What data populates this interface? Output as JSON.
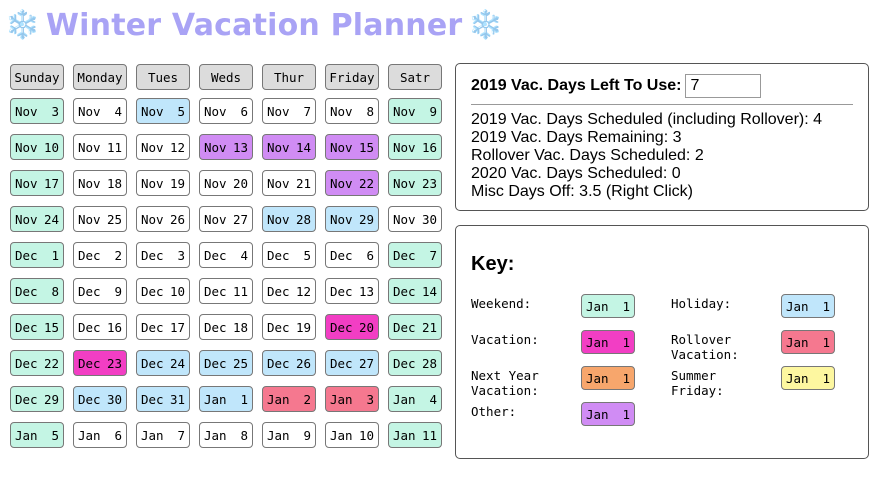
{
  "header": {
    "title": "Winter Vacation Planner",
    "icon_left": "❄️",
    "icon_right": "❄️"
  },
  "colors": {
    "weekend": "#c4f5e4",
    "holiday": "#c0e6fb",
    "vacation": "#f23ec4",
    "rollover": "#f5788f",
    "next_year": "#f7a66c",
    "summer_friday": "#fdf7a0",
    "other": "#d08cf4",
    "none": "#ffffff"
  },
  "calendar": {
    "headers": [
      "Sunday",
      "Monday",
      "Tues",
      "Weds",
      "Thur",
      "Friday",
      "Satr"
    ],
    "weeks": [
      [
        {
          "m": "Nov",
          "d": "3",
          "t": "weekend"
        },
        {
          "m": "Nov",
          "d": "4",
          "t": "none"
        },
        {
          "m": "Nov",
          "d": "5",
          "t": "holiday"
        },
        {
          "m": "Nov",
          "d": "6",
          "t": "none"
        },
        {
          "m": "Nov",
          "d": "7",
          "t": "none"
        },
        {
          "m": "Nov",
          "d": "8",
          "t": "none"
        },
        {
          "m": "Nov",
          "d": "9",
          "t": "weekend"
        }
      ],
      [
        {
          "m": "Nov",
          "d": "10",
          "t": "weekend"
        },
        {
          "m": "Nov",
          "d": "11",
          "t": "none"
        },
        {
          "m": "Nov",
          "d": "12",
          "t": "none"
        },
        {
          "m": "Nov",
          "d": "13",
          "t": "other"
        },
        {
          "m": "Nov",
          "d": "14",
          "t": "other"
        },
        {
          "m": "Nov",
          "d": "15",
          "t": "other"
        },
        {
          "m": "Nov",
          "d": "16",
          "t": "weekend"
        }
      ],
      [
        {
          "m": "Nov",
          "d": "17",
          "t": "weekend"
        },
        {
          "m": "Nov",
          "d": "18",
          "t": "none"
        },
        {
          "m": "Nov",
          "d": "19",
          "t": "none"
        },
        {
          "m": "Nov",
          "d": "20",
          "t": "none"
        },
        {
          "m": "Nov",
          "d": "21",
          "t": "none"
        },
        {
          "m": "Nov",
          "d": "22",
          "t": "other"
        },
        {
          "m": "Nov",
          "d": "23",
          "t": "weekend"
        }
      ],
      [
        {
          "m": "Nov",
          "d": "24",
          "t": "weekend"
        },
        {
          "m": "Nov",
          "d": "25",
          "t": "none"
        },
        {
          "m": "Nov",
          "d": "26",
          "t": "none"
        },
        {
          "m": "Nov",
          "d": "27",
          "t": "none"
        },
        {
          "m": "Nov",
          "d": "28",
          "t": "holiday"
        },
        {
          "m": "Nov",
          "d": "29",
          "t": "holiday"
        },
        {
          "m": "Nov",
          "d": "30",
          "t": "none"
        }
      ],
      [
        {
          "m": "Dec",
          "d": "1",
          "t": "weekend"
        },
        {
          "m": "Dec",
          "d": "2",
          "t": "none"
        },
        {
          "m": "Dec",
          "d": "3",
          "t": "none"
        },
        {
          "m": "Dec",
          "d": "4",
          "t": "none"
        },
        {
          "m": "Dec",
          "d": "5",
          "t": "none"
        },
        {
          "m": "Dec",
          "d": "6",
          "t": "none"
        },
        {
          "m": "Dec",
          "d": "7",
          "t": "weekend"
        }
      ],
      [
        {
          "m": "Dec",
          "d": "8",
          "t": "weekend"
        },
        {
          "m": "Dec",
          "d": "9",
          "t": "none"
        },
        {
          "m": "Dec",
          "d": "10",
          "t": "none"
        },
        {
          "m": "Dec",
          "d": "11",
          "t": "none"
        },
        {
          "m": "Dec",
          "d": "12",
          "t": "none"
        },
        {
          "m": "Dec",
          "d": "13",
          "t": "none"
        },
        {
          "m": "Dec",
          "d": "14",
          "t": "weekend"
        }
      ],
      [
        {
          "m": "Dec",
          "d": "15",
          "t": "weekend"
        },
        {
          "m": "Dec",
          "d": "16",
          "t": "none"
        },
        {
          "m": "Dec",
          "d": "17",
          "t": "none"
        },
        {
          "m": "Dec",
          "d": "18",
          "t": "none"
        },
        {
          "m": "Dec",
          "d": "19",
          "t": "none"
        },
        {
          "m": "Dec",
          "d": "20",
          "t": "vacation"
        },
        {
          "m": "Dec",
          "d": "21",
          "t": "weekend"
        }
      ],
      [
        {
          "m": "Dec",
          "d": "22",
          "t": "weekend"
        },
        {
          "m": "Dec",
          "d": "23",
          "t": "vacation"
        },
        {
          "m": "Dec",
          "d": "24",
          "t": "holiday"
        },
        {
          "m": "Dec",
          "d": "25",
          "t": "holiday"
        },
        {
          "m": "Dec",
          "d": "26",
          "t": "holiday"
        },
        {
          "m": "Dec",
          "d": "27",
          "t": "holiday"
        },
        {
          "m": "Dec",
          "d": "28",
          "t": "weekend"
        }
      ],
      [
        {
          "m": "Dec",
          "d": "29",
          "t": "weekend"
        },
        {
          "m": "Dec",
          "d": "30",
          "t": "holiday"
        },
        {
          "m": "Dec",
          "d": "31",
          "t": "holiday"
        },
        {
          "m": "Jan",
          "d": "1",
          "t": "holiday"
        },
        {
          "m": "Jan",
          "d": "2",
          "t": "rollover"
        },
        {
          "m": "Jan",
          "d": "3",
          "t": "rollover"
        },
        {
          "m": "Jan",
          "d": "4",
          "t": "weekend"
        }
      ],
      [
        {
          "m": "Jan",
          "d": "5",
          "t": "weekend"
        },
        {
          "m": "Jan",
          "d": "6",
          "t": "none"
        },
        {
          "m": "Jan",
          "d": "7",
          "t": "none"
        },
        {
          "m": "Jan",
          "d": "8",
          "t": "none"
        },
        {
          "m": "Jan",
          "d": "9",
          "t": "none"
        },
        {
          "m": "Jan",
          "d": "10",
          "t": "none"
        },
        {
          "m": "Jan",
          "d": "11",
          "t": "weekend"
        }
      ]
    ]
  },
  "summary": {
    "days_left_label": "2019 Vac. Days Left To Use:",
    "days_left_value": "7",
    "lines": [
      "2019 Vac. Days Scheduled (including Rollover): 4",
      "2019 Vac. Days Remaining: 3",
      "Rollover Vac. Days Scheduled: 2",
      "2020 Vac. Days Scheduled: 0",
      "Misc Days Off: 3.5 (Right Click)"
    ]
  },
  "key": {
    "title": "Key:",
    "sample_month": "Jan",
    "sample_day": "1",
    "items": [
      {
        "label": "Weekend:",
        "type": "weekend",
        "col": 0,
        "row": 0
      },
      {
        "label": "Holiday:",
        "type": "holiday",
        "col": 1,
        "row": 0
      },
      {
        "label": "Vacation:",
        "type": "vacation",
        "col": 0,
        "row": 1
      },
      {
        "label": "Rollover\nVacation:",
        "type": "rollover",
        "col": 1,
        "row": 1
      },
      {
        "label": "Next Year\nVacation:",
        "type": "next_year",
        "col": 0,
        "row": 2
      },
      {
        "label": "Summer\nFriday:",
        "type": "summer_friday",
        "col": 1,
        "row": 2
      },
      {
        "label": "Other:",
        "type": "other",
        "col": 0,
        "row": 3
      }
    ]
  }
}
